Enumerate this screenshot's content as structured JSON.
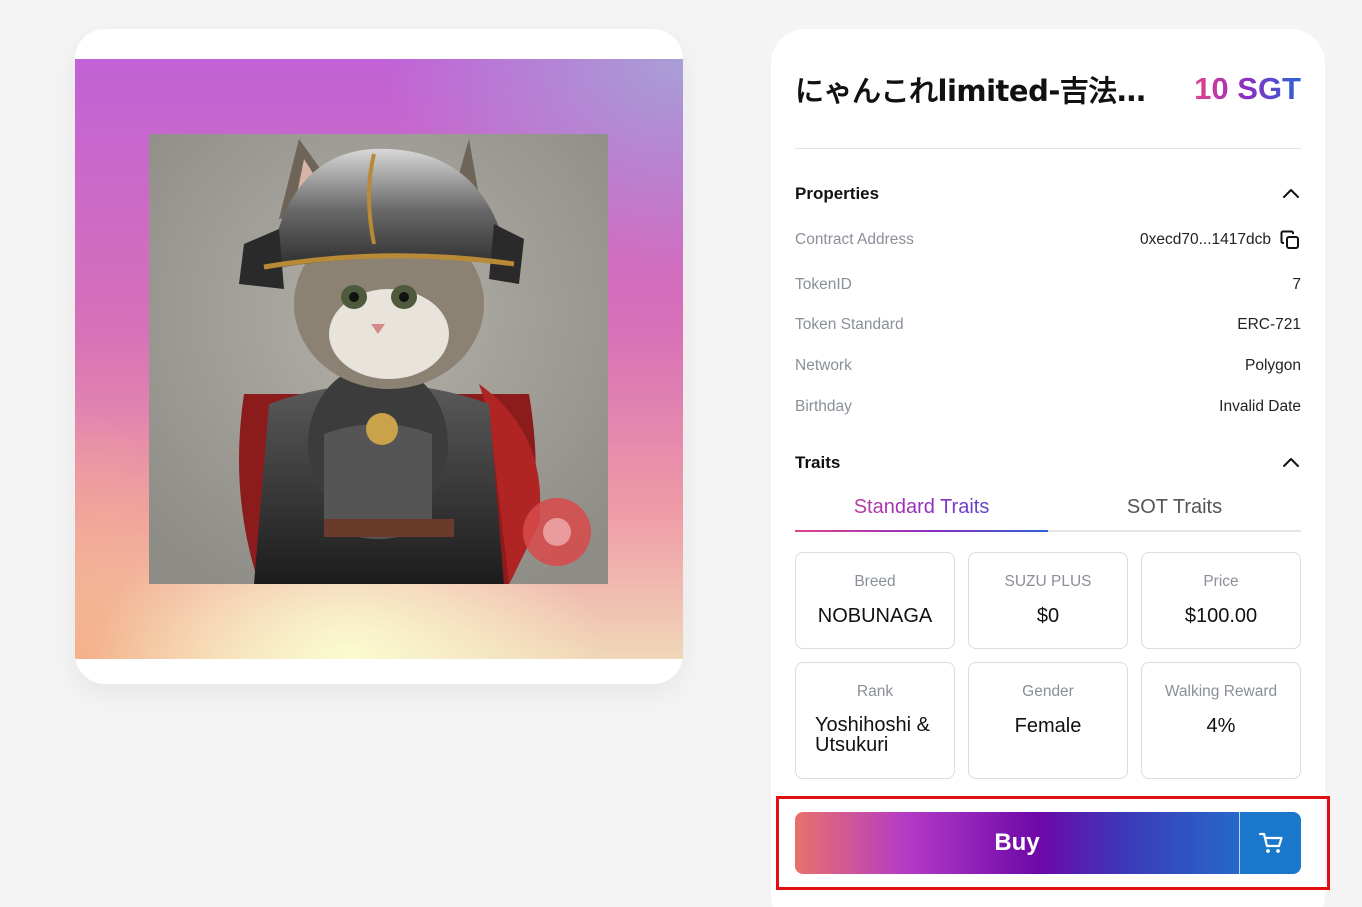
{
  "nft": {
    "title": "にゃんこれlimited-吉法…",
    "price": "10 SGT",
    "image_alt": "Samurai cat in armor"
  },
  "properties": {
    "label": "Properties",
    "rows": [
      {
        "key": "Contract Address",
        "value": "0xecd70...1417dcb"
      },
      {
        "key": "TokenID",
        "value": "7"
      },
      {
        "key": "Token Standard",
        "value": "ERC-721"
      },
      {
        "key": "Network",
        "value": "Polygon"
      },
      {
        "key": "Birthday",
        "value": "Invalid Date"
      }
    ]
  },
  "traits": {
    "label": "Traits",
    "tabs": [
      {
        "label": "Standard Traits",
        "active": true
      },
      {
        "label": "SOT Traits",
        "active": false
      }
    ],
    "items": [
      {
        "key": "Breed",
        "value": "NOBUNAGA"
      },
      {
        "key": "SUZU PLUS",
        "value": "$0"
      },
      {
        "key": "Price",
        "value": "$100.00"
      },
      {
        "key": "Rank",
        "value": "Yoshihoshi & Utsukuri"
      },
      {
        "key": "Gender",
        "value": "Female"
      },
      {
        "key": "Walking Reward",
        "value": "4%"
      }
    ]
  },
  "actions": {
    "buy_label": "Buy",
    "cart_icon": "cart-icon"
  },
  "colors": {
    "accent_pink": "#e2438a",
    "accent_purple": "#6d08a8",
    "accent_blue": "#1a78cc",
    "highlight_red": "#e01010"
  }
}
